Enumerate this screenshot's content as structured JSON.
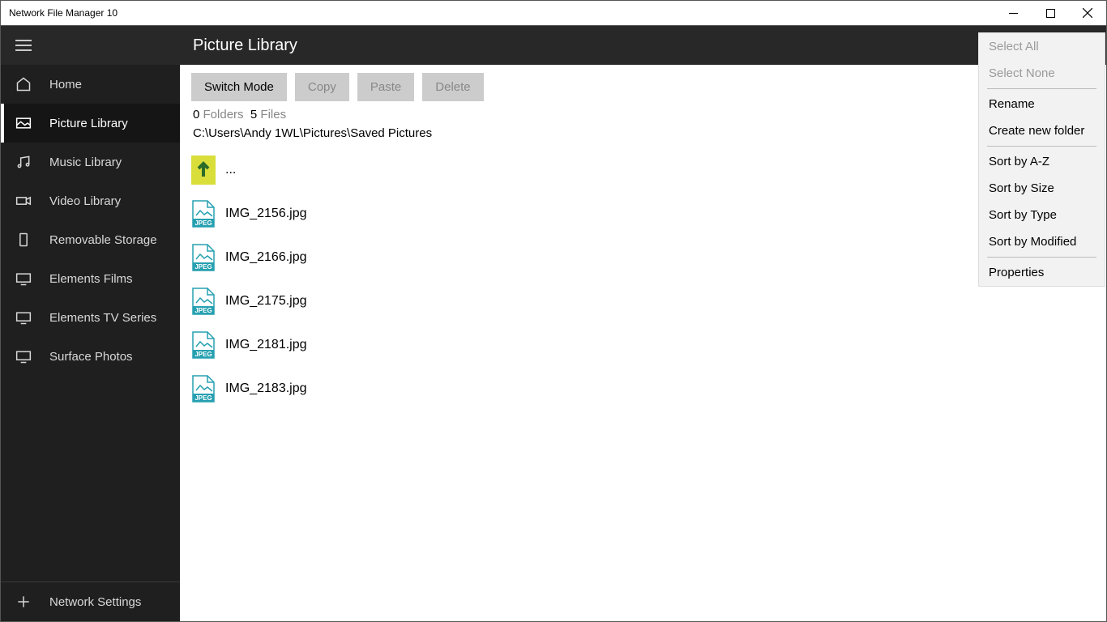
{
  "titlebar": {
    "title": "Network File Manager 10"
  },
  "sidebar": {
    "items": [
      {
        "label": "Home"
      },
      {
        "label": "Picture Library"
      },
      {
        "label": "Music Library"
      },
      {
        "label": "Video Library"
      },
      {
        "label": "Removable Storage"
      },
      {
        "label": "Elements Films"
      },
      {
        "label": "Elements TV Series"
      },
      {
        "label": "Surface Photos"
      }
    ],
    "footer": {
      "label": "Network Settings"
    }
  },
  "header": {
    "title": "Picture Library"
  },
  "toolbar": {
    "switch_mode": "Switch Mode",
    "copy": "Copy",
    "paste": "Paste",
    "delete": "Delete"
  },
  "status": {
    "folders_count": "0",
    "folders_label": "Folders",
    "files_count": "5",
    "files_label": "Files",
    "path": "C:\\Users\\Andy 1WL\\Pictures\\Saved Pictures"
  },
  "files": {
    "up": "...",
    "items": [
      "IMG_2156.jpg",
      "IMG_2166.jpg",
      "IMG_2175.jpg",
      "IMG_2181.jpg",
      "IMG_2183.jpg"
    ]
  },
  "context_menu": {
    "select_all": "Select All",
    "select_none": "Select None",
    "rename": "Rename",
    "create_folder": "Create new folder",
    "sort_az": "Sort by A-Z",
    "sort_size": "Sort by Size",
    "sort_type": "Sort by Type",
    "sort_modified": "Sort by Modified",
    "properties": "Properties"
  }
}
